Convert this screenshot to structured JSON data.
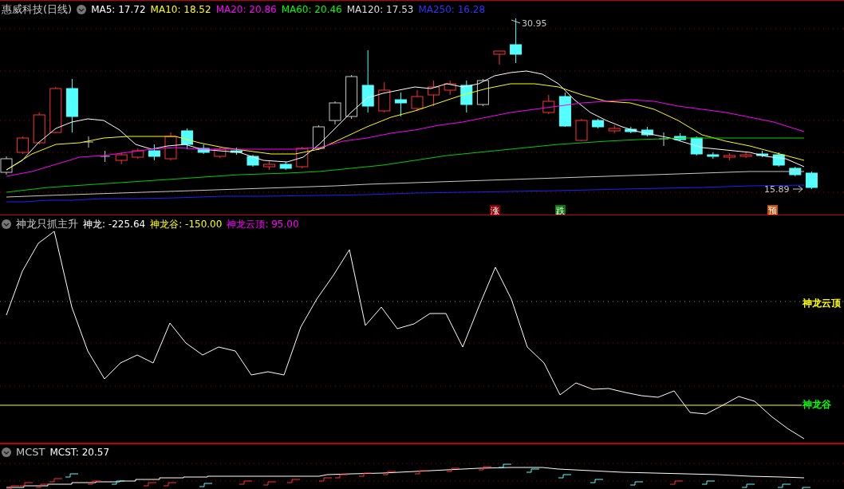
{
  "main_chart": {
    "title": "惠威科技(日线)",
    "indicators": [
      {
        "label": "MA5: 17.72",
        "color": "#ffffff"
      },
      {
        "label": "MA10: 18.52",
        "color": "#ffff00"
      },
      {
        "label": "MA20: 20.86",
        "color": "#ff00ff"
      },
      {
        "label": "MA60: 20.46",
        "color": "#00ff00"
      },
      {
        "label": "MA120: 17.53",
        "color": "#dddddd"
      },
      {
        "label": "MA250: 16.28",
        "color": "#3333ff"
      }
    ],
    "high_label": "30.95",
    "low_label": "15.89",
    "signals": [
      {
        "text": "涨",
        "color": "#8b0000"
      },
      {
        "text": "跌",
        "color": "#0a7a0a"
      },
      {
        "text": "预",
        "color": "#c0500a"
      }
    ]
  },
  "indicator_panel": {
    "title": "神龙只抓主升",
    "indicators": [
      {
        "label": "神龙: -225.64",
        "color": "#ffffff"
      },
      {
        "label": "神龙谷: -150.00",
        "color": "#ffff00"
      },
      {
        "label": "神龙云顶: 95.00",
        "color": "#ff00ff"
      }
    ],
    "levels": [
      {
        "label": "神龙云顶",
        "color": "#ffff00"
      },
      {
        "label": "神龙谷",
        "color": "#00ff00"
      }
    ]
  },
  "mcst_panel": {
    "title": "MCST",
    "indicators": [
      {
        "label": "MCST: 20.57",
        "color": "#ffffff"
      }
    ]
  }
}
